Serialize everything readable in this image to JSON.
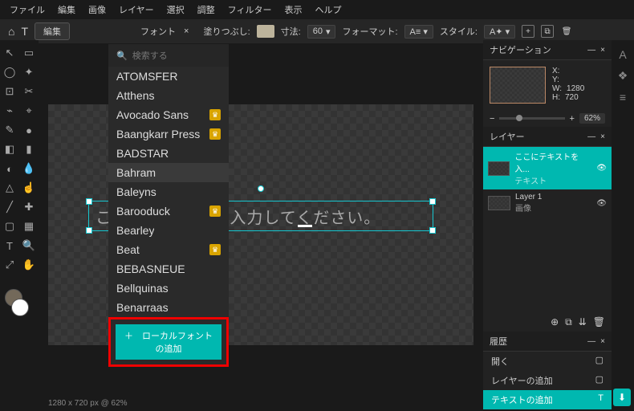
{
  "menu": [
    "ファイル",
    "編集",
    "画像",
    "レイヤー",
    "選択",
    "調整",
    "フィルター",
    "表示",
    "ヘルプ"
  ],
  "toolbar": {
    "edit": "編集",
    "font_tab": "フォント",
    "fill_label": "塗りつぶし:",
    "size_label": "寸法:",
    "size_value": "60",
    "format_label": "フォーマット:",
    "style_label": "スタイル:"
  },
  "font_panel": {
    "search_placeholder": "検索する",
    "add_local": "＋　ローカルフォントの追加",
    "fonts": [
      {
        "name": "ATOMSFER",
        "premium": false
      },
      {
        "name": "Atthens",
        "premium": false
      },
      {
        "name": "Avocado Sans",
        "premium": true
      },
      {
        "name": "Baangkarr Press",
        "premium": true
      },
      {
        "name": "BADSTAR",
        "premium": false
      },
      {
        "name": "Bahram",
        "premium": false,
        "selected": true
      },
      {
        "name": "Baleyns",
        "premium": false
      },
      {
        "name": "Barooduck",
        "premium": true
      },
      {
        "name": "Bearley",
        "premium": false
      },
      {
        "name": "Beat",
        "premium": true
      },
      {
        "name": "BEBASNEUE",
        "premium": false
      },
      {
        "name": "Bellquinas",
        "premium": false
      },
      {
        "name": "Benarraas",
        "premium": false
      }
    ]
  },
  "canvas_text": "ここにテキストを入力してください。",
  "nav": {
    "title": "ナビゲーション",
    "x": "X:",
    "y": "Y:",
    "w": "W:",
    "h": "H:",
    "wv": "1280",
    "hv": "720",
    "zoom": "62%"
  },
  "layers": {
    "title": "レイヤー",
    "items": [
      {
        "name": "ここにテキストを入...",
        "sub": "テキスト",
        "active": true
      },
      {
        "name": "Layer 1",
        "sub": "画像",
        "active": false
      }
    ]
  },
  "history": {
    "title": "履歴",
    "items": [
      {
        "name": "開く",
        "icon": "▢",
        "active": false
      },
      {
        "name": "レイヤーの追加",
        "icon": "▢",
        "active": false
      },
      {
        "name": "テキストの追加",
        "icon": "T",
        "active": true
      }
    ]
  },
  "status": "1280 x 720 px @ 62%"
}
